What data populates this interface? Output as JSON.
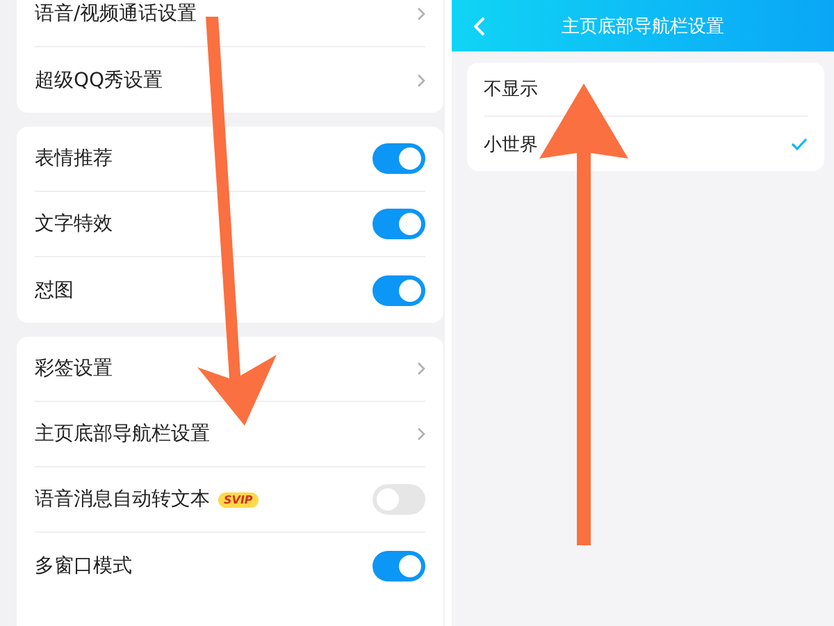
{
  "settings_groups": [
    {
      "items": [
        {
          "kind": "link",
          "label": "语音/视频通话设置"
        },
        {
          "kind": "link",
          "label": "超级QQ秀设置"
        }
      ]
    },
    {
      "items": [
        {
          "kind": "toggle",
          "label": "表情推荐",
          "on": true
        },
        {
          "kind": "toggle",
          "label": "文字特效",
          "on": true
        },
        {
          "kind": "toggle",
          "label": "怼图",
          "on": true
        }
      ]
    },
    {
      "items": [
        {
          "kind": "link",
          "label": "彩签设置"
        },
        {
          "kind": "link",
          "label": "主页底部导航栏设置"
        },
        {
          "kind": "toggle",
          "label": "语音消息自动转文本",
          "badge": "SVIP",
          "on": false
        },
        {
          "kind": "toggle",
          "label": "多窗口模式",
          "on": true
        }
      ]
    }
  ],
  "nav_settings": {
    "title": "主页底部导航栏设置",
    "options": [
      {
        "label": "不显示",
        "selected": false
      },
      {
        "label": "小世界",
        "selected": true
      }
    ]
  }
}
